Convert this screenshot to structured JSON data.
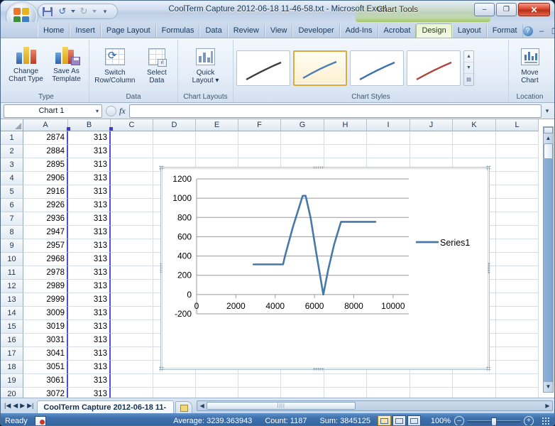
{
  "window": {
    "title": "CoolTerm Capture 2012-06-18 11-46-58.txt - Microsoft Excel",
    "contextual_tools_label": "Chart Tools",
    "minimize": "–",
    "maximize": "❐",
    "close": "✕"
  },
  "quick_access": {
    "save_icon": "save-icon",
    "undo_icon": "undo-icon",
    "redo_icon": "redo-icon",
    "customize_icon": "chevron-down-icon"
  },
  "ribbon": {
    "tabs": [
      {
        "label": "Home",
        "active": false
      },
      {
        "label": "Insert",
        "active": false
      },
      {
        "label": "Page Layout",
        "active": false
      },
      {
        "label": "Formulas",
        "active": false
      },
      {
        "label": "Data",
        "active": false
      },
      {
        "label": "Review",
        "active": false
      },
      {
        "label": "View",
        "active": false
      },
      {
        "label": "Developer",
        "active": false
      },
      {
        "label": "Add-Ins",
        "active": false
      },
      {
        "label": "Acrobat",
        "active": false
      },
      {
        "label": "Design",
        "active": true
      },
      {
        "label": "Layout",
        "active": false
      },
      {
        "label": "Format",
        "active": false
      }
    ],
    "window_controls": {
      "help": "?",
      "minimize_ribbon": "–",
      "restore": "❐",
      "close": "✕"
    },
    "groups": [
      {
        "name": "Type",
        "label": "Type",
        "buttons": [
          {
            "label_line1": "Change",
            "label_line2": "Chart Type",
            "icon": "chart-type-icon"
          },
          {
            "label_line1": "Save As",
            "label_line2": "Template",
            "icon": "save-template-icon"
          }
        ]
      },
      {
        "name": "Data",
        "label": "Data",
        "buttons": [
          {
            "label_line1": "Switch",
            "label_line2": "Row/Column",
            "icon": "switch-row-column-icon"
          },
          {
            "label_line1": "Select",
            "label_line2": "Data",
            "icon": "select-data-icon"
          }
        ]
      },
      {
        "name": "Chart Layouts",
        "label": "Chart Layouts",
        "buttons": [
          {
            "label_line1": "Quick",
            "label_line2": "Layout ▾",
            "icon": "quick-layout-icon"
          }
        ]
      },
      {
        "name": "Chart Styles",
        "label": "Chart Styles",
        "gallery": [
          {
            "name": "style-1",
            "line_color": "#3d3d3d",
            "selected": false
          },
          {
            "name": "style-2",
            "line_color": "#4a7ebb",
            "selected": true
          },
          {
            "name": "style-3",
            "line_color": "#3f6fae",
            "selected": false
          },
          {
            "name": "style-4",
            "line_color": "#b0443c",
            "selected": false
          }
        ],
        "scroll": {
          "up": "▲",
          "down": "▼",
          "more": "▤"
        }
      },
      {
        "name": "Location",
        "label": "Location",
        "buttons": [
          {
            "label_line1": "Move",
            "label_line2": "Chart",
            "icon": "move-chart-icon"
          }
        ]
      }
    ]
  },
  "formula_bar": {
    "name_box_value": "Chart 1",
    "name_box_arrow": "▾",
    "fx_label": "fx",
    "formula_value": "",
    "expand_icon": "chevron-down-icon"
  },
  "grid": {
    "columns": [
      "A",
      "B",
      "C",
      "D",
      "E",
      "F",
      "G",
      "H",
      "I",
      "J",
      "K",
      "L"
    ],
    "rows": [
      {
        "num": "1",
        "A": "2874",
        "B": "313"
      },
      {
        "num": "2",
        "A": "2884",
        "B": "313"
      },
      {
        "num": "3",
        "A": "2895",
        "B": "313"
      },
      {
        "num": "4",
        "A": "2906",
        "B": "313"
      },
      {
        "num": "5",
        "A": "2916",
        "B": "313"
      },
      {
        "num": "6",
        "A": "2926",
        "B": "313"
      },
      {
        "num": "7",
        "A": "2936",
        "B": "313"
      },
      {
        "num": "8",
        "A": "2947",
        "B": "313"
      },
      {
        "num": "9",
        "A": "2957",
        "B": "313"
      },
      {
        "num": "10",
        "A": "2968",
        "B": "313"
      },
      {
        "num": "11",
        "A": "2978",
        "B": "313"
      },
      {
        "num": "12",
        "A": "2989",
        "B": "313"
      },
      {
        "num": "13",
        "A": "2999",
        "B": "313"
      },
      {
        "num": "14",
        "A": "3009",
        "B": "313"
      },
      {
        "num": "15",
        "A": "3019",
        "B": "313"
      },
      {
        "num": "16",
        "A": "3031",
        "B": "313"
      },
      {
        "num": "17",
        "A": "3041",
        "B": "313"
      },
      {
        "num": "18",
        "A": "3051",
        "B": "313"
      },
      {
        "num": "19",
        "A": "3061",
        "B": "313"
      },
      {
        "num": "20",
        "A": "3072",
        "B": "313"
      }
    ]
  },
  "chart_data": {
    "type": "line",
    "title": "",
    "xlabel": "",
    "ylabel": "",
    "legend": [
      "Series1"
    ],
    "legend_position": "right",
    "grid": true,
    "line_color": "#4878a8",
    "xlim": [
      0,
      10800
    ],
    "ylim": [
      -200,
      1200
    ],
    "xticks": [
      0,
      2000,
      4000,
      6000,
      8000,
      10000
    ],
    "xtick_labels": [
      "0",
      "2000",
      "4000",
      "6000",
      "8000",
      "10000"
    ],
    "yticks": [
      -200,
      0,
      200,
      400,
      600,
      800,
      1000,
      1200
    ],
    "ytick_labels": [
      "-200",
      "0",
      "200",
      "400",
      "600",
      "800",
      "1000",
      "1200"
    ],
    "series": [
      {
        "name": "Series1",
        "x": [
          2900,
          3400,
          3900,
          4400,
          4500,
          4900,
          5400,
          5550,
          5800,
          6100,
          6450,
          6700,
          7000,
          7350,
          7800,
          8400,
          9100
        ],
        "y": [
          313,
          313,
          313,
          313,
          400,
          700,
          1025,
          1025,
          800,
          420,
          0,
          260,
          520,
          755,
          755,
          755,
          755
        ]
      }
    ]
  },
  "chart_object": {
    "selected": true,
    "name": "Chart 1"
  },
  "sheet_bar": {
    "nav": [
      "|◀",
      "◀",
      "▶",
      "▶|"
    ],
    "tabs": [
      {
        "label": "CoolTerm Capture 2012-06-18 11-",
        "active": true
      }
    ],
    "new_sheet_icon": "new-sheet-icon",
    "hscroll": {
      "left": "◀",
      "right": "▶",
      "grip": "||||"
    }
  },
  "status_bar": {
    "state": "Ready",
    "record_macro_icon": "record-macro-icon",
    "average": "Average: 3239.363943",
    "count": "Count: 1187",
    "sum": "Sum: 3845125",
    "views": [
      {
        "name": "normal-view",
        "active": true
      },
      {
        "name": "page-layout-view",
        "active": false
      },
      {
        "name": "page-break-preview",
        "active": false
      }
    ],
    "zoom": "100%",
    "zoom_out": "–",
    "zoom_in": "+"
  }
}
